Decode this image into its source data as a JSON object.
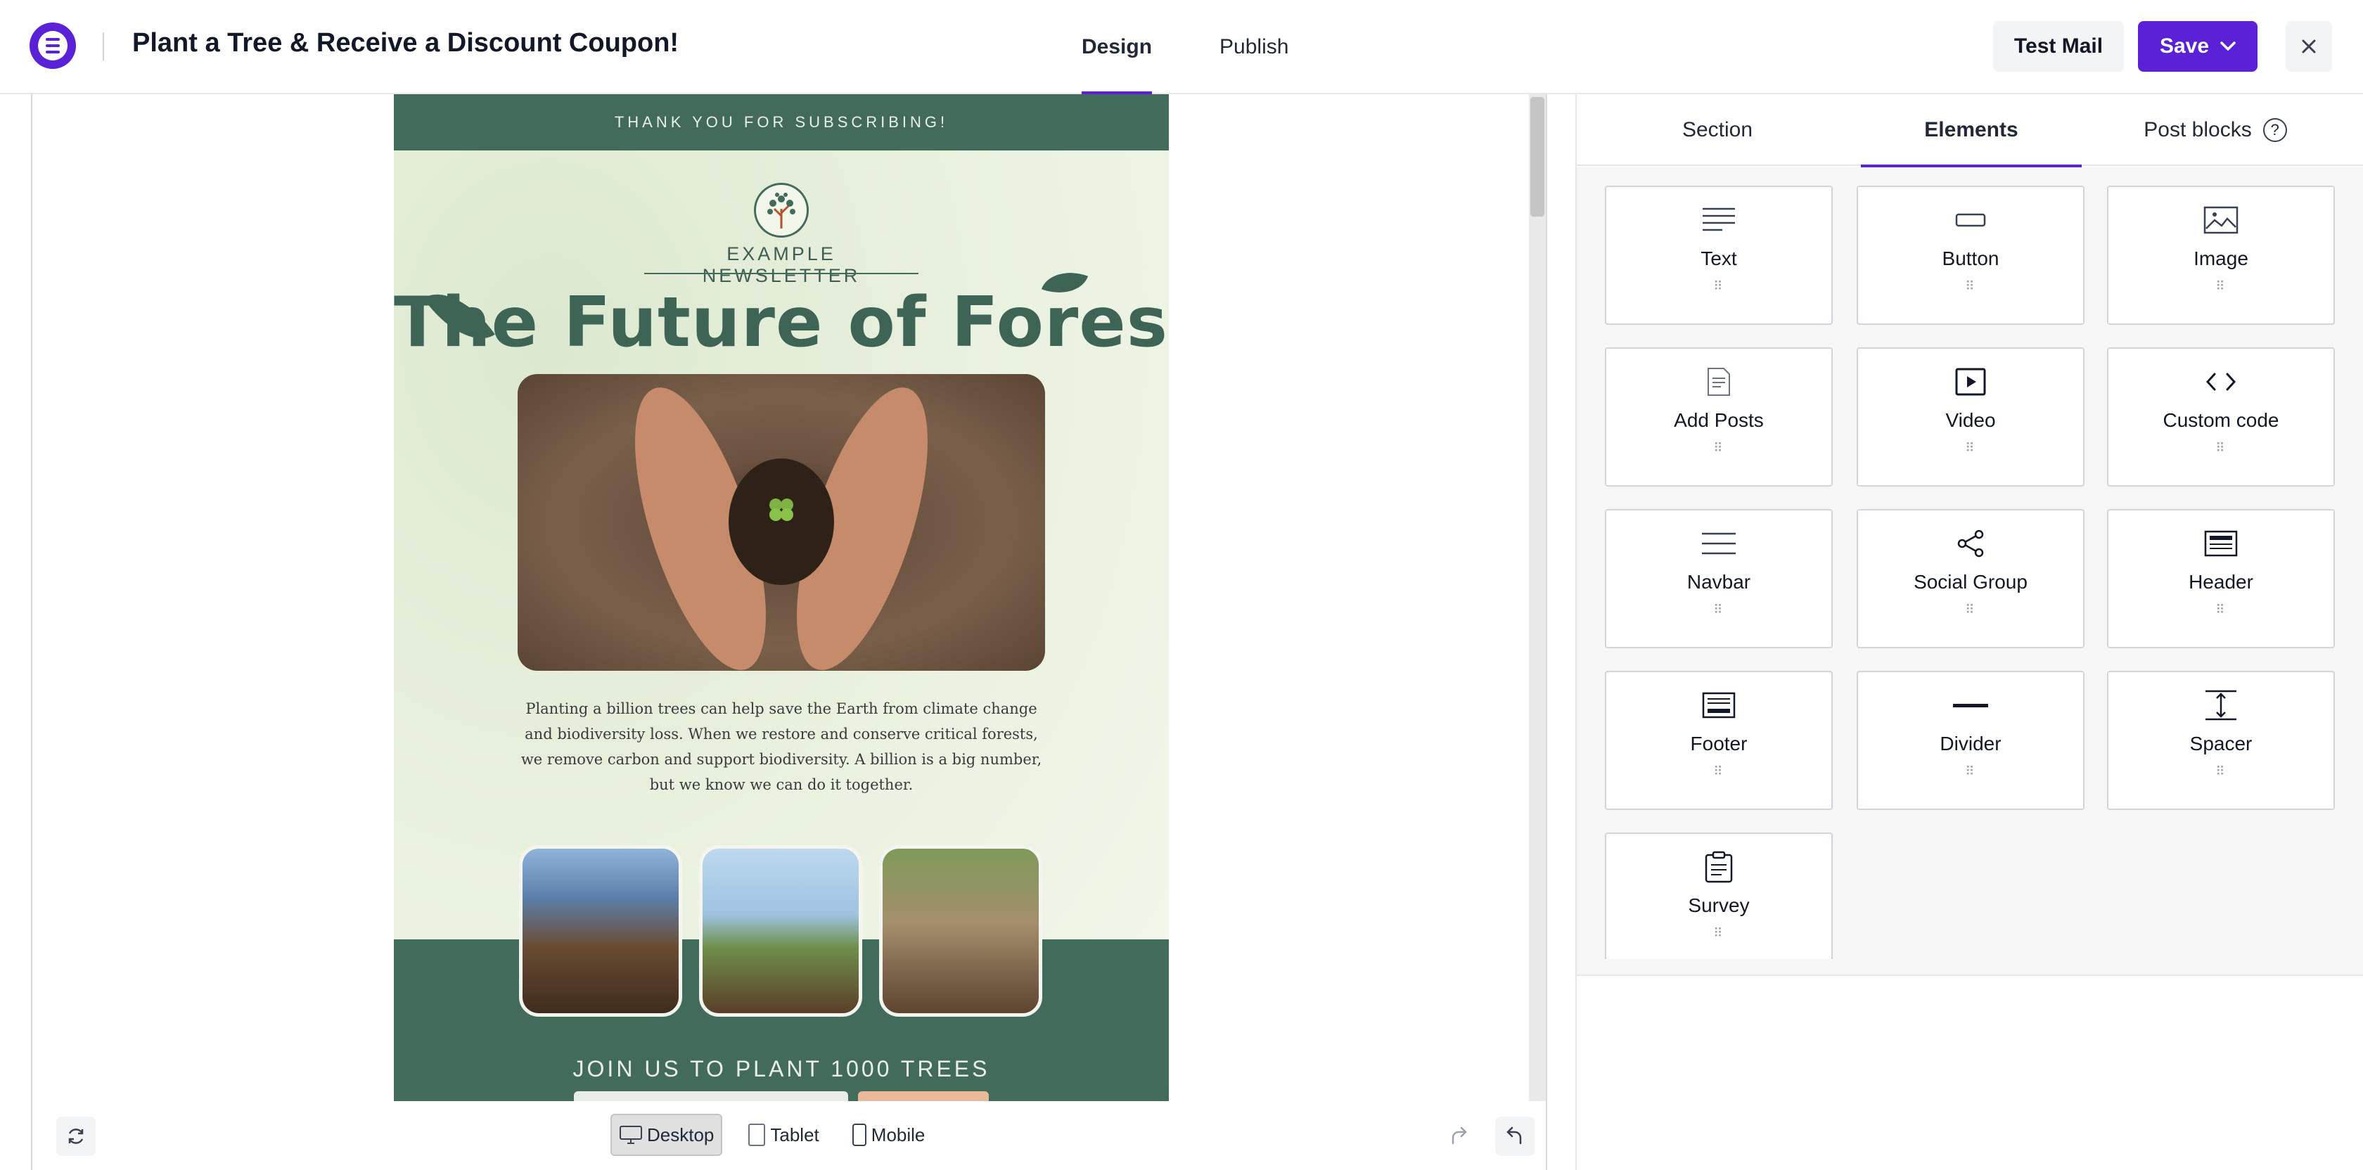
{
  "app": {
    "title": "Plant a Tree & Receive a Discount Coupon!",
    "accent": "#5b21d6"
  },
  "header": {
    "tabs": [
      {
        "label": "Design",
        "active": true
      },
      {
        "label": "Publish",
        "active": false
      }
    ],
    "test_mail_label": "Test Mail",
    "save_label": "Save"
  },
  "email": {
    "top_banner": "THANK YOU FOR SUBSCRIBING!",
    "newsletter_label": "EXAMPLE NEWSLETTER",
    "headline": "The Future of Forest",
    "body": "Planting a billion trees can help save the Earth from climate change and biodiversity loss. When we restore and conserve critical forests, we remove carbon and support biodiversity. A billion is a big number, but we know we can do it together.",
    "join_text": "JOIN US TO PLANT 1000 TREES",
    "colors": {
      "primary": "#436b5c",
      "background": "#eaf1e2"
    }
  },
  "devices": {
    "items": [
      {
        "label": "Desktop",
        "icon": "desktop-icon",
        "active": true
      },
      {
        "label": "Tablet",
        "icon": "tablet-icon",
        "active": false
      },
      {
        "label": "Mobile",
        "icon": "mobile-icon",
        "active": false
      }
    ]
  },
  "panel": {
    "tabs": [
      {
        "label": "Section",
        "active": false
      },
      {
        "label": "Elements",
        "active": true
      },
      {
        "label": "Post blocks",
        "active": false
      }
    ],
    "elements": [
      {
        "label": "Text",
        "icon": "text-icon"
      },
      {
        "label": "Button",
        "icon": "button-icon"
      },
      {
        "label": "Image",
        "icon": "image-icon"
      },
      {
        "label": "Add Posts",
        "icon": "add-posts-icon"
      },
      {
        "label": "Video",
        "icon": "video-icon"
      },
      {
        "label": "Custom code",
        "icon": "code-icon"
      },
      {
        "label": "Navbar",
        "icon": "navbar-icon"
      },
      {
        "label": "Social Group",
        "icon": "share-icon"
      },
      {
        "label": "Header",
        "icon": "header-icon"
      },
      {
        "label": "Footer",
        "icon": "footer-icon"
      },
      {
        "label": "Divider",
        "icon": "divider-icon"
      },
      {
        "label": "Spacer",
        "icon": "spacer-icon"
      },
      {
        "label": "Survey",
        "icon": "survey-icon"
      }
    ]
  }
}
